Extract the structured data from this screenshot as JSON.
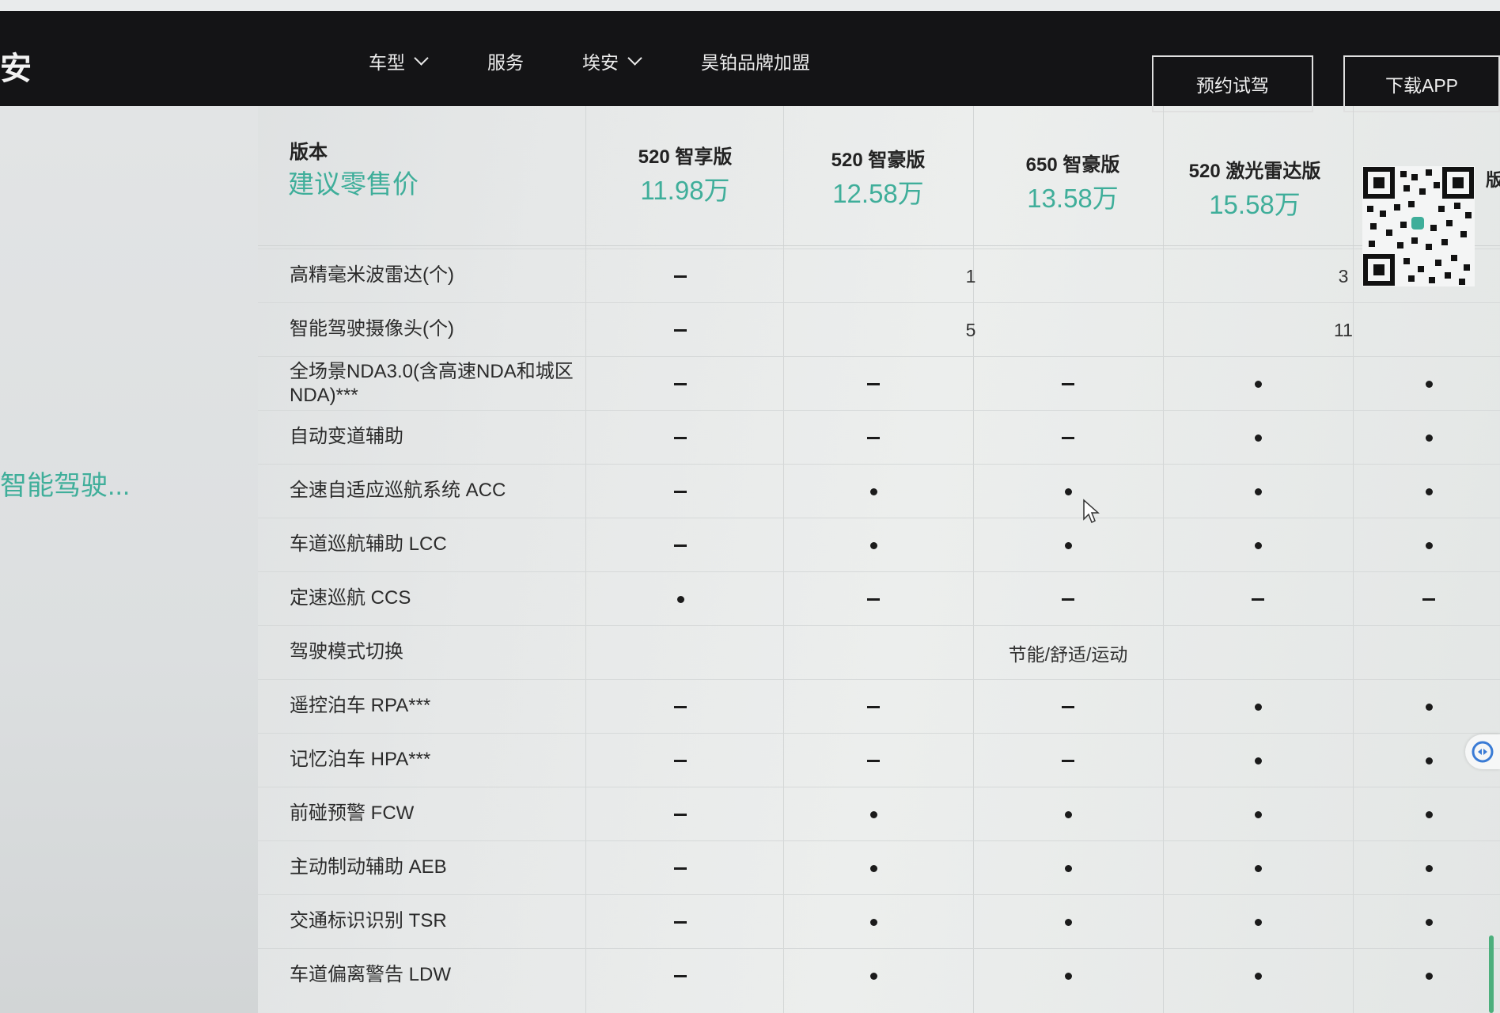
{
  "nav": {
    "brand": "安",
    "items": [
      "车型",
      "服务",
      "埃安",
      "昊铂品牌加盟"
    ],
    "test_drive": "预约试驾",
    "download_app": "下载APP"
  },
  "left": {
    "category": "智能驾驶..."
  },
  "table": {
    "header": {
      "version_label": "版本",
      "price_label": "建议零售价"
    },
    "versions": [
      {
        "name": "520 智享版",
        "price": "11.98万"
      },
      {
        "name": "520 智豪版",
        "price": "12.58万"
      },
      {
        "name": "650 智豪版",
        "price": "13.58万"
      },
      {
        "name": "520 激光雷达版",
        "price": "15.58万"
      },
      {
        "name": "版",
        "price": ""
      }
    ],
    "rows": [
      {
        "label": "高精毫米波雷达(个)",
        "cells": [
          "-",
          "1",
          "1",
          "3",
          "3"
        ],
        "merged": [
          0,
          1,
          3
        ]
      },
      {
        "label": "智能驾驶摄像头(个)",
        "cells": [
          "-",
          "5",
          "5",
          "11",
          "11"
        ],
        "merged": [
          0,
          1,
          3
        ]
      },
      {
        "label": "全场景NDA3.0(含高速NDA和城区NDA)***",
        "cells": [
          "-",
          "-",
          "-",
          "●",
          "●"
        ]
      },
      {
        "label": "自动变道辅助",
        "cells": [
          "-",
          "-",
          "-",
          "●",
          "●"
        ]
      },
      {
        "label": "全速自适应巡航系统 ACC",
        "cells": [
          "-",
          "●",
          "●",
          "●",
          "●"
        ]
      },
      {
        "label": "车道巡航辅助 LCC",
        "cells": [
          "-",
          "●",
          "●",
          "●",
          "●"
        ]
      },
      {
        "label": "定速巡航 CCS",
        "cells": [
          "●",
          "-",
          "-",
          "-",
          "-"
        ]
      },
      {
        "label": "驾驶模式切换",
        "merged_text": "节能/舒适/运动"
      },
      {
        "label": "遥控泊车 RPA***",
        "cells": [
          "-",
          "-",
          "-",
          "●",
          "●"
        ]
      },
      {
        "label": "记忆泊车 HPA***",
        "cells": [
          "-",
          "-",
          "-",
          "●",
          "●"
        ]
      },
      {
        "label": "前碰预警 FCW",
        "cells": [
          "-",
          "●",
          "●",
          "●",
          "●"
        ]
      },
      {
        "label": "主动制动辅助 AEB",
        "cells": [
          "-",
          "●",
          "●",
          "●",
          "●"
        ]
      },
      {
        "label": "交通标识识别 TSR",
        "cells": [
          "-",
          "●",
          "●",
          "●",
          "●"
        ]
      },
      {
        "label": "车道偏离警告 LDW",
        "cells": [
          "-",
          "●",
          "●",
          "●",
          "●"
        ]
      }
    ]
  },
  "colors": {
    "accent": "#3fae9a",
    "nav_bg": "#141416"
  },
  "icons": [
    "chevron-down-icon",
    "qr-code-icon",
    "help-float-icon",
    "cursor-icon"
  ]
}
